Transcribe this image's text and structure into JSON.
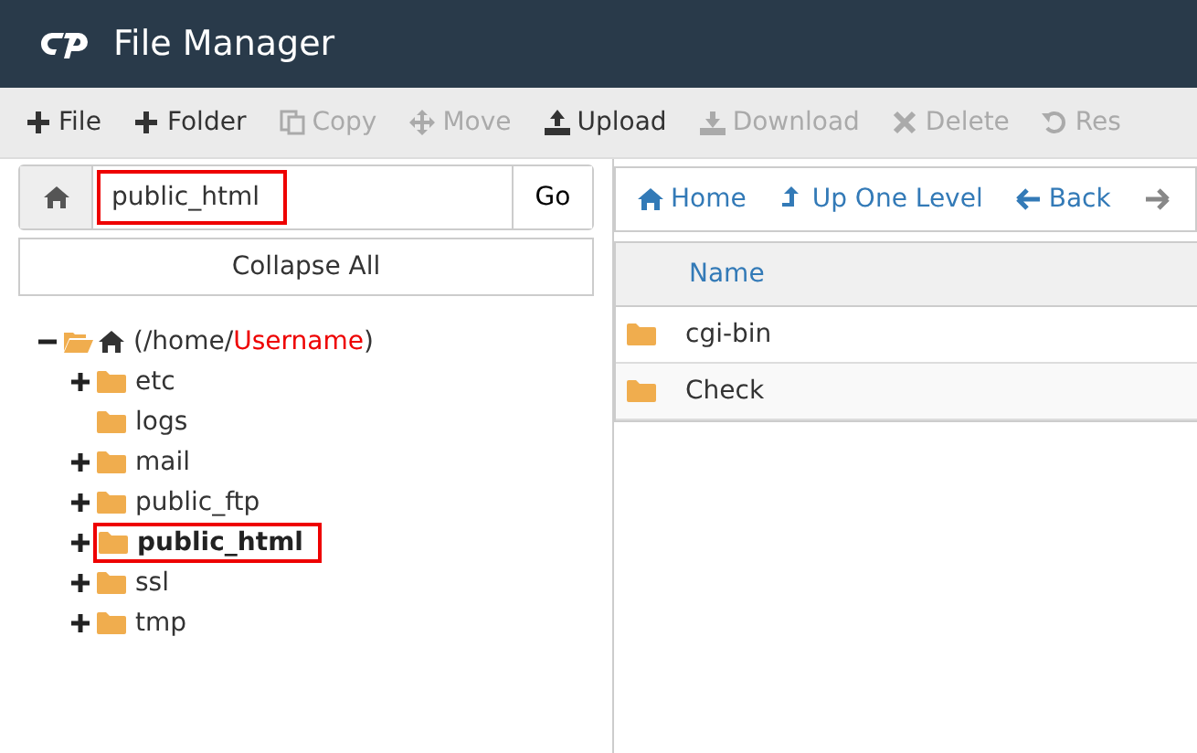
{
  "window": {
    "title": "File Manager"
  },
  "toolbar": [
    {
      "label": "File",
      "kind": "plus",
      "disabled": false
    },
    {
      "label": "Folder",
      "kind": "plus",
      "disabled": false
    },
    {
      "label": "Copy",
      "kind": "copy",
      "disabled": true
    },
    {
      "label": "Move",
      "kind": "move",
      "disabled": true
    },
    {
      "label": "Upload",
      "kind": "upload",
      "disabled": false
    },
    {
      "label": "Download",
      "kind": "download",
      "disabled": true
    },
    {
      "label": "Delete",
      "kind": "delete",
      "disabled": true
    },
    {
      "label": "Res",
      "kind": "undo",
      "disabled": true
    }
  ],
  "path_bar": {
    "value": "public_html",
    "highlighted": true,
    "button": "Go"
  },
  "collapse_button": "Collapse All",
  "tree": {
    "prefix": "(/home/",
    "annotation": "Username",
    "suffix": ")",
    "expanded": true,
    "children": [
      {
        "label": "etc",
        "expandable": true,
        "selected": false,
        "highlighted": false
      },
      {
        "label": "logs",
        "expandable": false,
        "selected": false,
        "highlighted": false
      },
      {
        "label": "mail",
        "expandable": true,
        "selected": false,
        "highlighted": false
      },
      {
        "label": "public_ftp",
        "expandable": true,
        "selected": false,
        "highlighted": false
      },
      {
        "label": "public_html",
        "expandable": true,
        "selected": true,
        "highlighted": true
      },
      {
        "label": "ssl",
        "expandable": true,
        "selected": false,
        "highlighted": false
      },
      {
        "label": "tmp",
        "expandable": true,
        "selected": false,
        "highlighted": false
      }
    ]
  },
  "nav": [
    {
      "label": "Home",
      "kind": "home"
    },
    {
      "label": "Up One Level",
      "kind": "up"
    },
    {
      "label": "Back",
      "kind": "back"
    },
    {
      "kind": "forward"
    }
  ],
  "table": {
    "columns": [
      "Name"
    ],
    "rows": [
      {
        "name": "cgi-bin"
      },
      {
        "name": "Check"
      }
    ]
  }
}
